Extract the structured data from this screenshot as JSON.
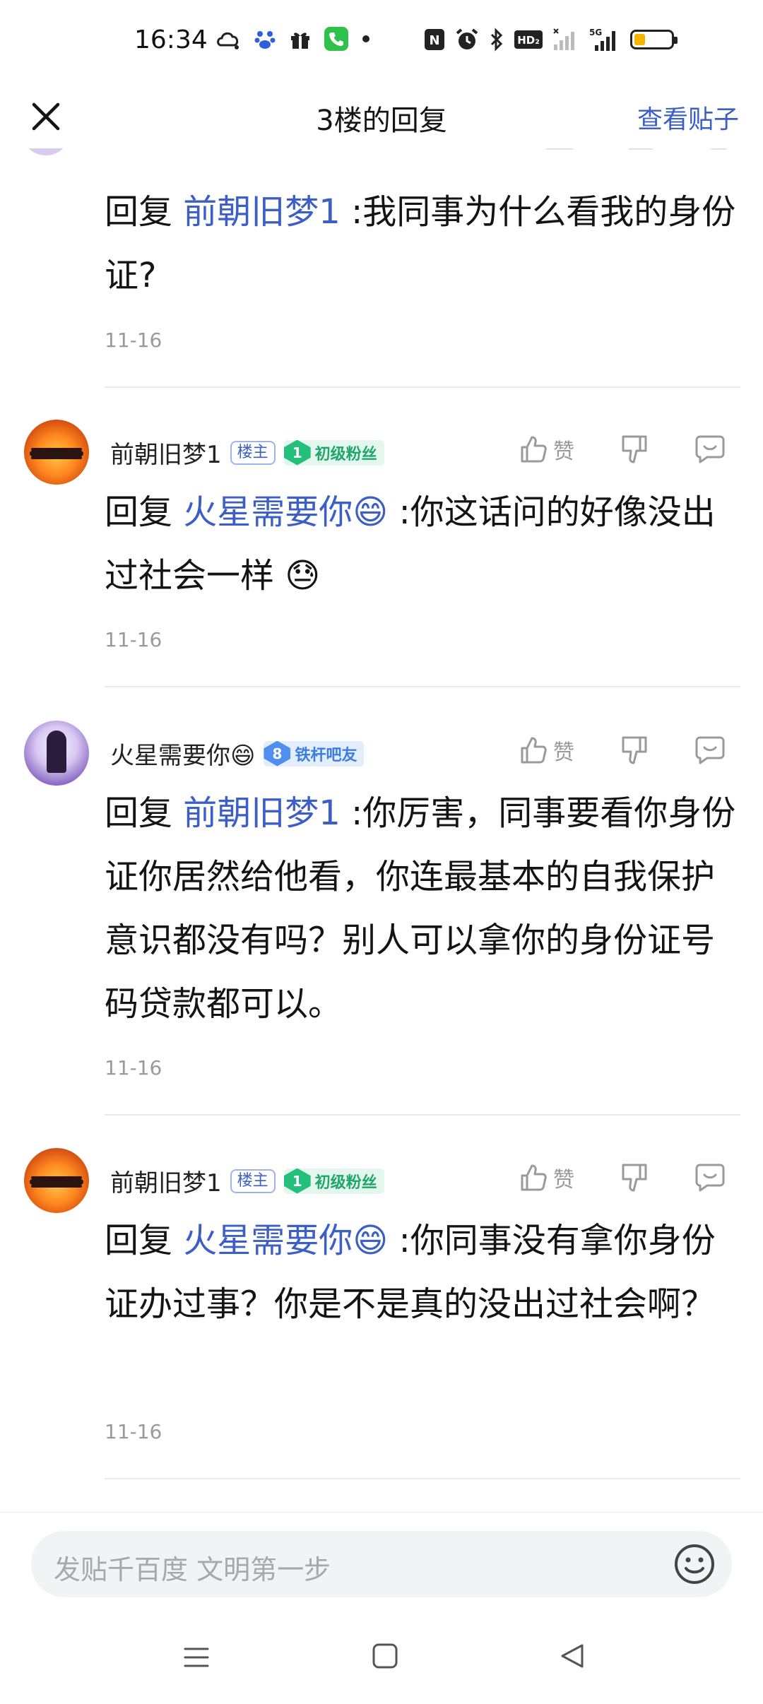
{
  "status_bar": {
    "time": "16:34",
    "left_icons": [
      "cloud-chat-icon",
      "baidu-paw-icon",
      "gift-icon",
      "phone-call-icon",
      "dot-icon"
    ],
    "right_icons": [
      "nfc-icon",
      "alarm-icon",
      "bluetooth-icon",
      "hd-volte-icon",
      "signal-icon",
      "5g-signal-icon",
      "battery-icon"
    ],
    "hd_label": "HD₂",
    "net_label": "5G",
    "battery_level": 0.3,
    "battery_color": "#f4b400"
  },
  "nav": {
    "title": "3楼的回复",
    "action": "查看贴子"
  },
  "replies": [
    {
      "user": "",
      "prefix": "回复",
      "mention": "前朝旧梦1",
      "text": " :我同事为什么看我的身份证?",
      "date": "11-16"
    },
    {
      "user": "前朝旧梦1",
      "owner_tag": "楼主",
      "badge_level": "1",
      "badge_text": "初级粉丝",
      "like_label": "赞",
      "prefix": "回复",
      "mention": "火星需要你😄",
      "text": " :你这话问的好像没出过社会一样 😓",
      "date": "11-16"
    },
    {
      "user": "火星需要你😄",
      "badge_level": "8",
      "badge_text": "铁杆吧友",
      "like_label": "赞",
      "prefix": "回复",
      "mention": "前朝旧梦1",
      "text": " :你厉害，同事要看你身份证你居然给他看，你连最基本的自我保护意识都没有吗？别人可以拿你的身份证号码贷款都可以。",
      "date": "11-16"
    },
    {
      "user": "前朝旧梦1",
      "owner_tag": "楼主",
      "badge_level": "1",
      "badge_text": "初级粉丝",
      "like_label": "赞",
      "prefix": "回复",
      "mention": "火星需要你😄",
      "text": " :你同事没有拿你身份证办过事？你是不是真的没出过社会啊？",
      "date": "11-16"
    }
  ],
  "input": {
    "placeholder": "发贴千百度 文明第一步"
  },
  "colors": {
    "accent": "#3b5ec7",
    "badge_green": "#22c07a",
    "badge_blue": "#4f8ff0"
  }
}
